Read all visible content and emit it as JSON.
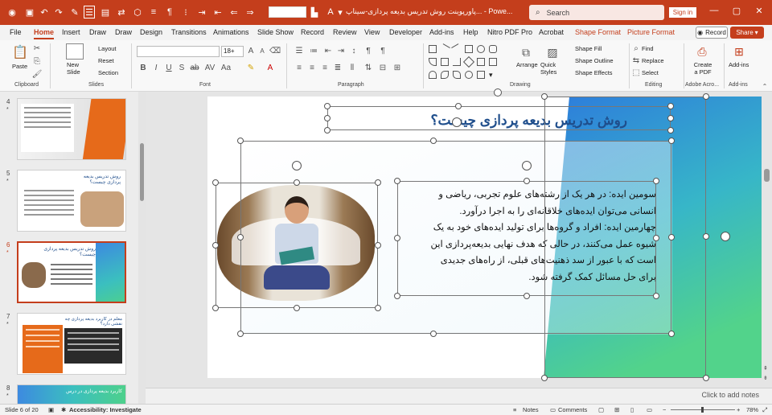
{
  "titlebar": {
    "title": "پاورپوینت روش تدریس بدیعه پردازی-سیناپ...   - Powe...",
    "search_placeholder": "Search",
    "sign_in": "Sign in",
    "accent": "#c43e1c"
  },
  "tabs": [
    "File",
    "Home",
    "Insert",
    "Draw",
    "Draw",
    "Design",
    "Transitions",
    "Animations",
    "Slide Show",
    "Record",
    "Review",
    "View",
    "Developer",
    "Add-ins",
    "Help",
    "Nitro PDF Pro",
    "Acrobat",
    "Shape Format",
    "Picture Format"
  ],
  "record_label": "Record",
  "share_label": "Share",
  "ribbon": {
    "clipboard": {
      "paste": "Paste",
      "label": "Clipboard"
    },
    "slides": {
      "new_slide": "New Slide",
      "layout": "Layout",
      "reset": "Reset",
      "section": "Section",
      "label": "Slides"
    },
    "font": {
      "size": "18+",
      "label": "Font"
    },
    "paragraph": {
      "label": "Paragraph"
    },
    "drawing": {
      "arrange": "Arrange",
      "quick_styles": "Quick Styles",
      "shape_fill": "Shape Fill",
      "shape_outline": "Shape Outline",
      "shape_effects": "Shape Effects",
      "label": "Drawing"
    },
    "editing": {
      "find": "Find",
      "replace": "Replace",
      "select": "Select",
      "label": "Editing"
    },
    "adobe": {
      "create_pdf": "Create a PDF",
      "label": "Adobe Acro..."
    },
    "addins": {
      "addins": "Add-ins",
      "label": "Add-ins"
    }
  },
  "thumbnails": [
    {
      "num": "4",
      "star": "*"
    },
    {
      "num": "5",
      "star": "*",
      "title": "روش تدریس بدیعه پردازی چیست؟"
    },
    {
      "num": "6",
      "star": "*",
      "title": "روش تدریس بدیعه پردازی چیست؟"
    },
    {
      "num": "7",
      "star": "*",
      "title": "معلم در کاربرد بدیعه پردازی چه نقشی دارد؟"
    },
    {
      "num": "8",
      "star": "*",
      "title": "کاربرد بدیعه پردازی در درس"
    }
  ],
  "slide": {
    "title": "روش تدریس بدیعه پردازی چیست؟",
    "body": [
      "سومین ایده: در هر یک از رشته‌های علوم تجربی، ریاضی و",
      "انسانی می‌توان ایده‌های خلاقانه‌ای را به اجرا درآورد.",
      "چهارمین ایده: افراد و گروه‌ها برای تولید ایده‌های خود به یک",
      "شیوه عمل می‌کنند، در حالی که هدف نهایی بدیعه‌پردازی این",
      "است که با عبور از سد ذهنیت‌های قبلی، از راه‌های جدیدی",
      "برای حل مسائل کمک گرفته شود."
    ]
  },
  "notes_placeholder": "Click to add notes",
  "status": {
    "slide_of": "Slide 6 of 20",
    "accessibility": "Accessibility: Investigate",
    "notes": "Notes",
    "comments": "Comments",
    "zoom": "78%"
  }
}
